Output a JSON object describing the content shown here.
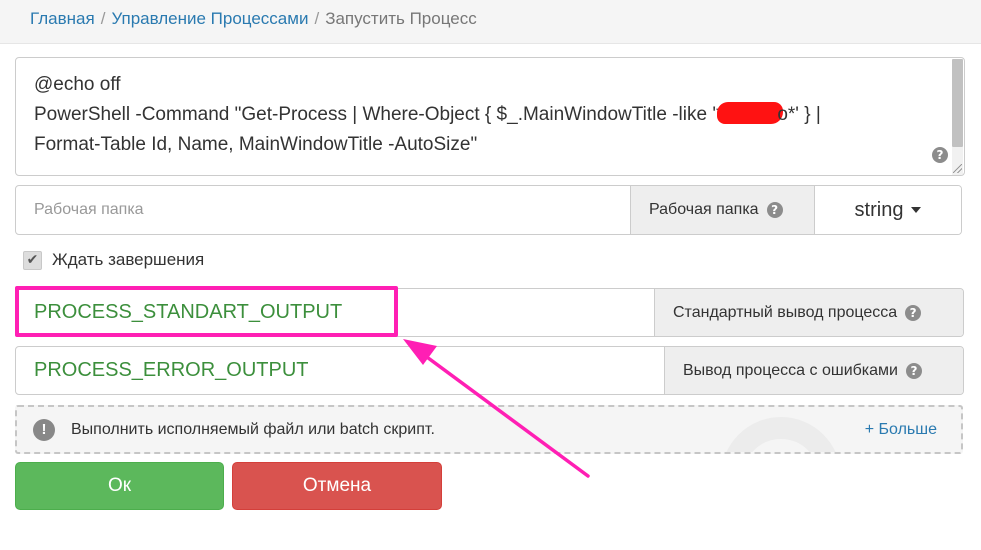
{
  "breadcrumb": {
    "items": [
      "Главная",
      "Управление Процессами"
    ],
    "separator": "/",
    "current": "Запустить Процесс"
  },
  "command": {
    "line1": "@echo off",
    "line2_before_redaction": "PowerShell -Command \"Get-Process | Where-Object { $_.MainWindowTitle -like '*",
    "line2_after_redaction": "o*' } |",
    "line3": "Format-Table Id, Name, MainWindowTitle -AutoSize\"",
    "help_icon": "question-circle-icon"
  },
  "working_dir": {
    "placeholder": "Рабочая папка",
    "addon_label": "Рабочая папка",
    "type_value": "string"
  },
  "wait": {
    "label": "Ждать завершения",
    "checked": true,
    "check_glyph": "✔"
  },
  "stdout": {
    "value": "PROCESS_STANDART_OUTPUT",
    "addon_label": "Стандартный вывод процесса"
  },
  "stderr": {
    "value": "PROCESS_ERROR_OUTPUT",
    "addon_label": "Вывод процесса с ошибками"
  },
  "info": {
    "icon_glyph": "!",
    "text": "Выполнить исполняемый файл или batch скрипт.",
    "more_link": "+ Больше"
  },
  "buttons": {
    "ok": "Ок",
    "cancel": "Отмена"
  },
  "help_glyph": "?",
  "colors": {
    "link": "#2a7ab0",
    "green_value": "#3c8f3c",
    "ok": "#5cb85c",
    "cancel": "#d9534f",
    "annotation": "#ff1fb4",
    "redaction": "#ff1212"
  }
}
